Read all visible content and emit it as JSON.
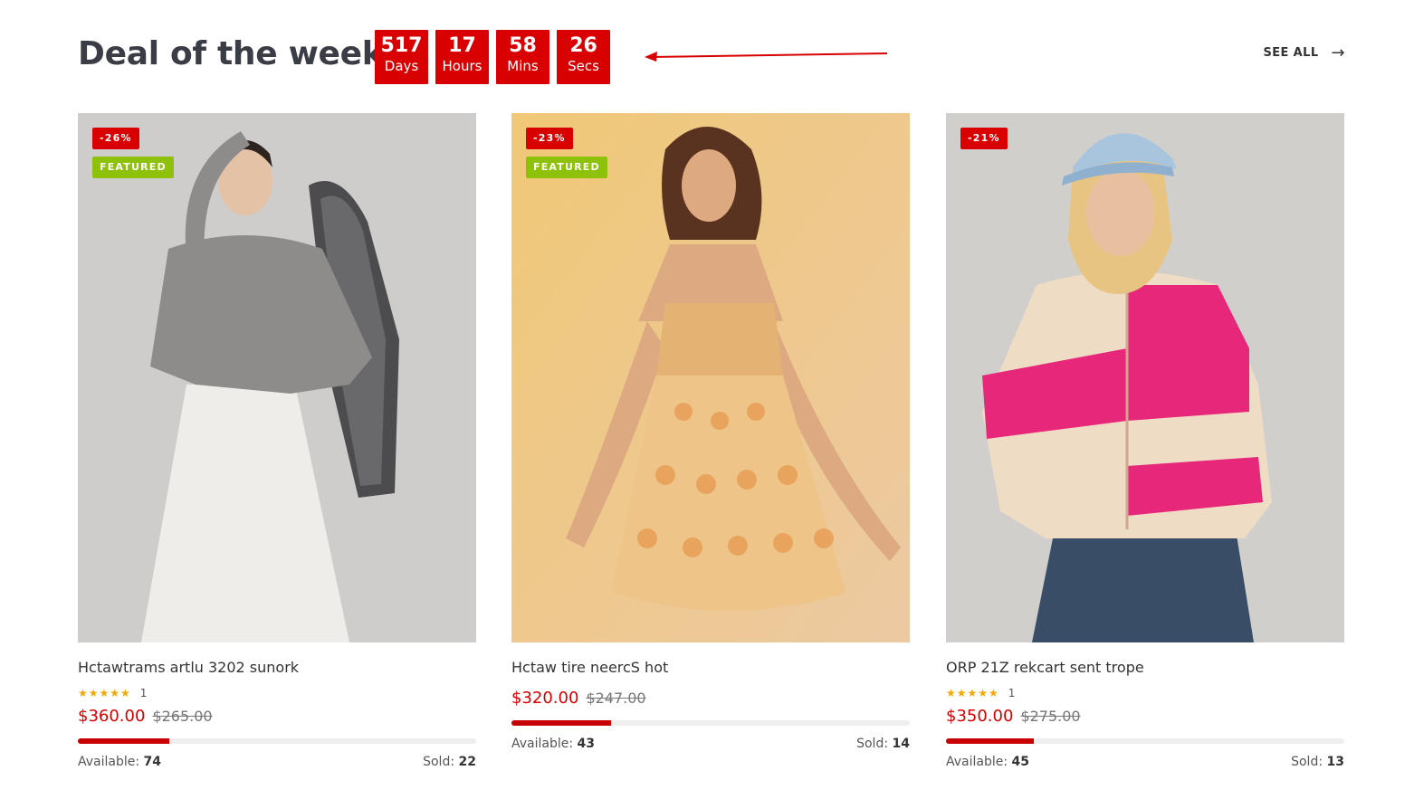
{
  "header": {
    "title": "Deal of the week",
    "see_all": "SEE ALL",
    "see_all_icon": "arrow-right-icon"
  },
  "countdown": [
    {
      "value": "517",
      "label": "Days"
    },
    {
      "value": "17",
      "label": "Hours"
    },
    {
      "value": "58",
      "label": "Mins"
    },
    {
      "value": "26",
      "label": "Secs"
    }
  ],
  "colors": {
    "accent": "#d80000",
    "featured": "#8dc10a",
    "star": "#f6a600"
  },
  "products": [
    {
      "discount": "-26%",
      "featured": "FEATURED",
      "name": "Hctawtrams artlu 3202 sunork",
      "stars": "★★★★★",
      "rating_count": "1",
      "price": "$360.00",
      "old_price": "$265.00",
      "sold_fraction": 0.23,
      "available_label": "Available:",
      "available": "74",
      "sold_label": "Sold:",
      "sold": "22"
    },
    {
      "discount": "-23%",
      "featured": "FEATURED",
      "name": "Hctaw tire neercS hot",
      "stars": "",
      "rating_count": "",
      "price": "$320.00",
      "old_price": "$247.00",
      "sold_fraction": 0.25,
      "available_label": "Available:",
      "available": "43",
      "sold_label": "Sold:",
      "sold": "14"
    },
    {
      "discount": "-21%",
      "featured": "",
      "name": "ORP 21Z rekcart sent trope",
      "stars": "★★★★★",
      "rating_count": "1",
      "price": "$350.00",
      "old_price": "$275.00",
      "sold_fraction": 0.22,
      "available_label": "Available:",
      "available": "45",
      "sold_label": "Sold:",
      "sold": "13"
    }
  ]
}
